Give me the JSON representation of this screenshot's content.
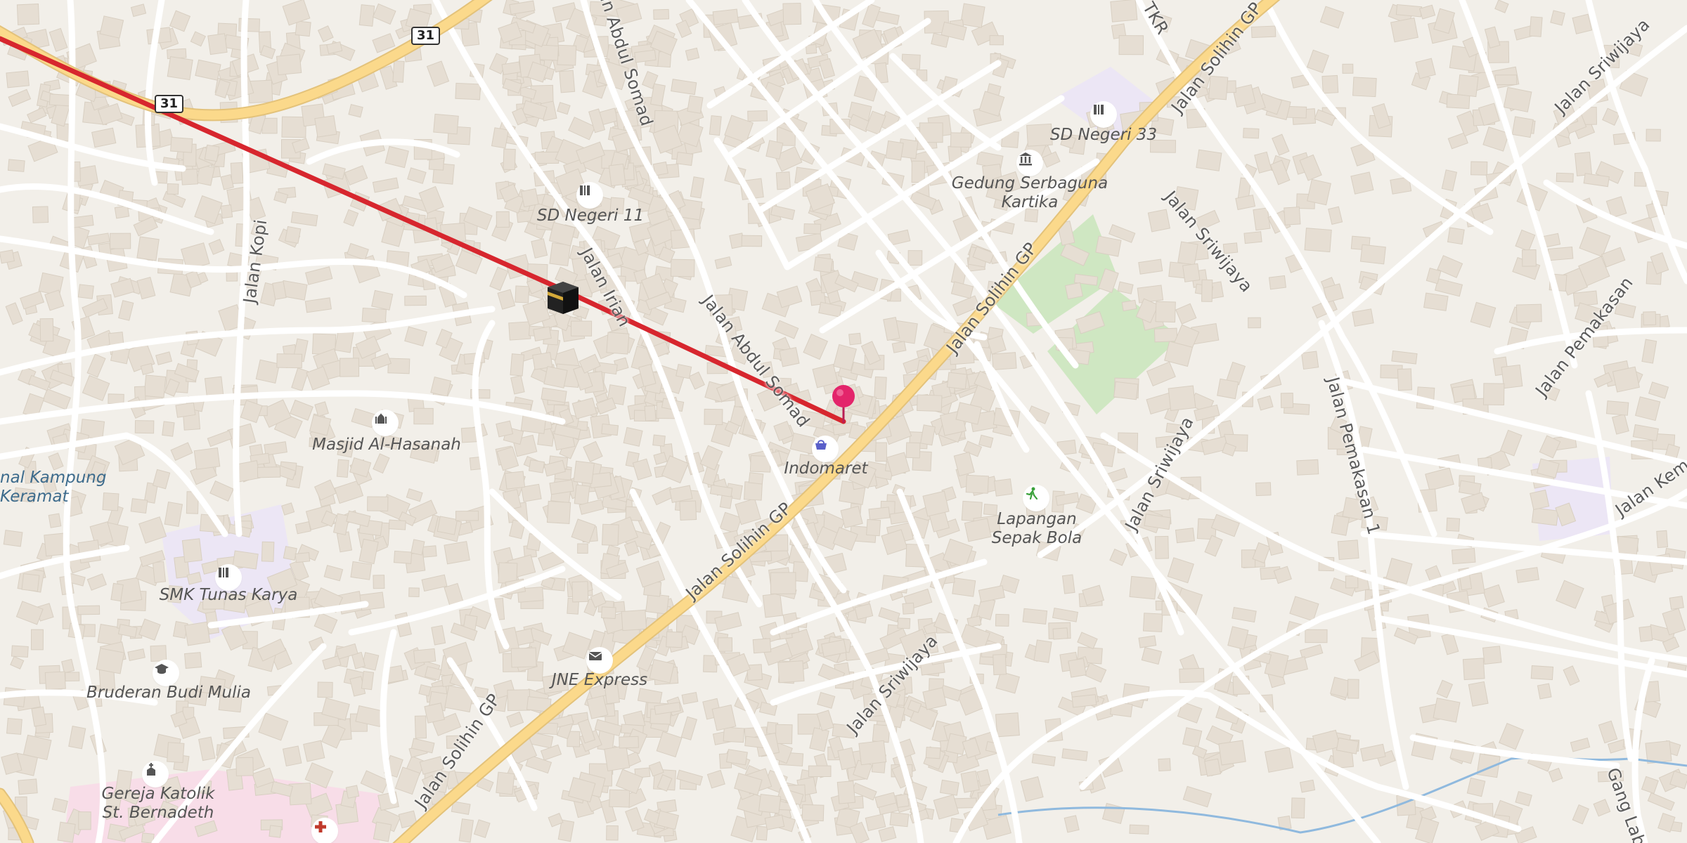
{
  "map": {
    "route_shields": [
      {
        "label": "31"
      },
      {
        "label": "31"
      }
    ],
    "roads": {
      "abdul_somad_top": "Jalan Abdul Somad",
      "abdul_somad_mid": "Jalan Abdul Somad",
      "irian": "Jalan Irian",
      "kopi": "Jalan Kopi",
      "solihin_top": "Jalan Solihin GP",
      "solihin_mid": "Jalan Solihin GP",
      "solihin_low": "Jalan Solihin GP",
      "solihin_bottom": "Jalan Solihin GP",
      "sriwijaya_a": "Jalan Sriwijaya",
      "sriwijaya_b": "Jalan Sriwijaya",
      "sriwijaya_c": "Jalan Sriwijaya",
      "sriwijaya_d": "Jalan Sriwijaya",
      "pemakasan": "Jalan Pemakasan",
      "pemakasan_1": "Jalan Pemakasan 1",
      "kem": "Jalan Kem",
      "tkr": "TKR",
      "gang": "Gang Lab"
    },
    "pois": {
      "sd11": "SD Negeri 11",
      "sd33": "SD Negeri 33",
      "gedung": "Gedung Serbaguna\nKartika",
      "masjid": "Masjid Al-Hasanah",
      "indomaret": "Indomaret",
      "lapangan": "Lapangan\nSepak Bola",
      "smk": "SMK Tunas Karya",
      "bruderan": "Bruderan Budi Mulia",
      "jne": "JNE Express",
      "gereja": "Gereja Katolik\nSt. Bernadeth",
      "kampung": "nal Kampung\nKeramat"
    },
    "colors": {
      "route_line": "#d7262e",
      "primary_road": "#fbd98b",
      "primary_road_casing": "#e3c27a",
      "minor_road": "#ffffff",
      "park": "#cfe7c2",
      "school_area": "#ece6f5",
      "hospital_area": "#f8dde8",
      "water": "#8fb9de",
      "building": "#e6ded3",
      "marker": "#e3256b"
    },
    "icons": {
      "kaaba": "kaaba-icon",
      "pin": "location-pin-icon",
      "school": "school-icon",
      "museum": "museum-icon",
      "mosque": "mosque-icon",
      "shop": "shopping-basket-icon",
      "sport": "soccer-player-icon",
      "education": "graduation-cap-icon",
      "post": "mail-icon",
      "church": "church-icon",
      "hospital": "hospital-cross-icon"
    }
  }
}
